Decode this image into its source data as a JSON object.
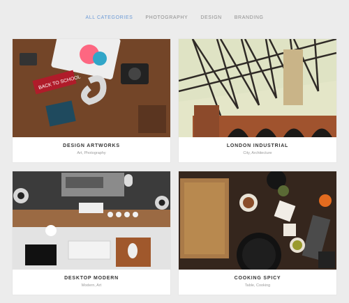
{
  "filters": [
    {
      "label": "ALL CATEGORIES",
      "active": true
    },
    {
      "label": "PHOTOGRAPHY",
      "active": false
    },
    {
      "label": "DESIGN",
      "active": false
    },
    {
      "label": "BRANDING",
      "active": false
    }
  ],
  "portfolio": [
    {
      "title": "DESIGN ARTWORKS",
      "categories": "Art, Photography"
    },
    {
      "title": "LONDON INDUSTRIAL",
      "categories": "City, Architecture"
    },
    {
      "title": "DESKTOP MODERN",
      "categories": "Modern, Art"
    },
    {
      "title": "COOKING SPICY",
      "categories": "Table, Cooking"
    }
  ],
  "colors": {
    "accent": "#6d9bd6",
    "muted": "#8e8e8e",
    "background": "#ececec"
  }
}
